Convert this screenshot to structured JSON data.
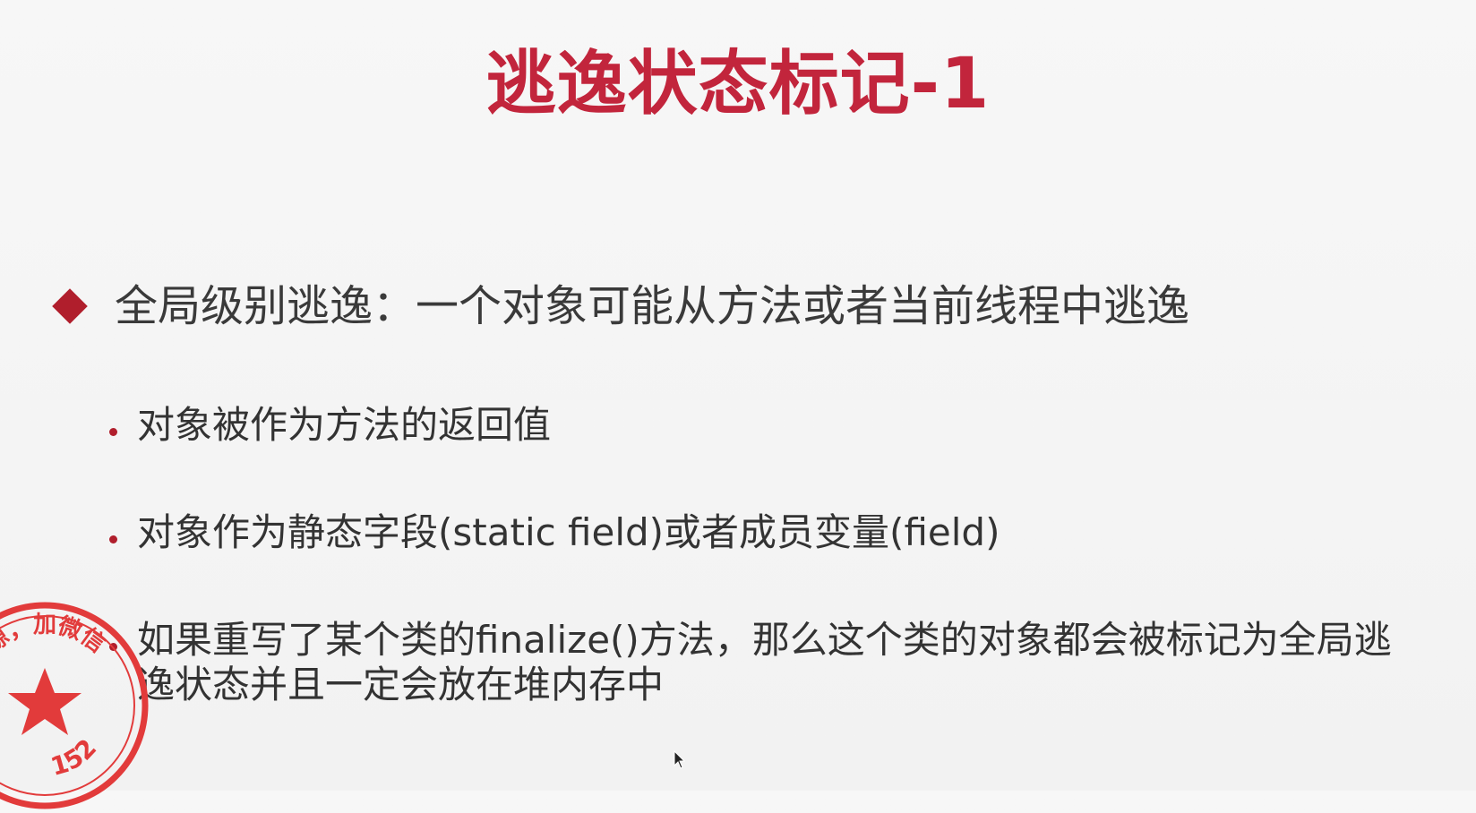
{
  "slide": {
    "title": "逃逸状态标记-1",
    "title_color": "#c2253c",
    "accent_color": "#b01e2c",
    "main_bullet": {
      "icon": "diamond-bullet-icon",
      "text": "全局级别逃逸：一个对象可能从方法或者当前线程中逃逸"
    },
    "sub_bullets": [
      {
        "icon": "dot-bullet-icon",
        "text": "对象被作为方法的返回值"
      },
      {
        "icon": "dot-bullet-icon",
        "text": "对象作为静态字段(static field)或者成员变量(field)"
      },
      {
        "icon": "dot-bullet-icon",
        "text": "如果重写了某个类的finalize()方法，那么这个类的对象都会被标记为全局逃逸状态并且一定会放在堆内存中"
      }
    ]
  },
  "watermark": {
    "icon": "red-star-stamp-icon",
    "color": "#e23b3b",
    "text_top": "源，加微信",
    "text_bottom": "152"
  },
  "cursor": {
    "icon": "mouse-pointer-icon"
  }
}
